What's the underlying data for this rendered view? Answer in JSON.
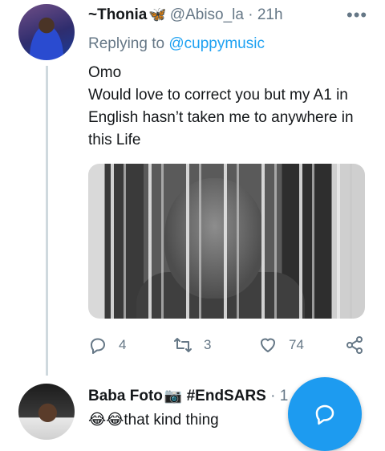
{
  "tweet": {
    "display_name": "~Thonia",
    "name_emoji": "🦋",
    "handle": "@Abiso_la",
    "separator": "·",
    "time": "21h",
    "more": "•••",
    "replying_prefix": "Replying to",
    "replying_to": "@cuppymusic",
    "text_line1": "Omo",
    "text_line2": "Would love to correct you  but my A1 in English hasn’t taken me to anywhere in this Life",
    "reply_count": "4",
    "retweet_count": "3",
    "like_count": "74"
  },
  "reply": {
    "display_name": "Baba Foto",
    "name_emoji": "📷",
    "hashtag": "#EndSARS",
    "trailing": "· 1",
    "emoji": "😂😂",
    "text": "that kind thing"
  },
  "colors": {
    "accent": "#1d9bf0",
    "muted": "#657786",
    "text": "#14171a"
  },
  "icons": {
    "reply": "reply-icon",
    "retweet": "retweet-icon",
    "like": "heart-icon",
    "share": "share-icon",
    "compose": "compose-reply-icon"
  }
}
